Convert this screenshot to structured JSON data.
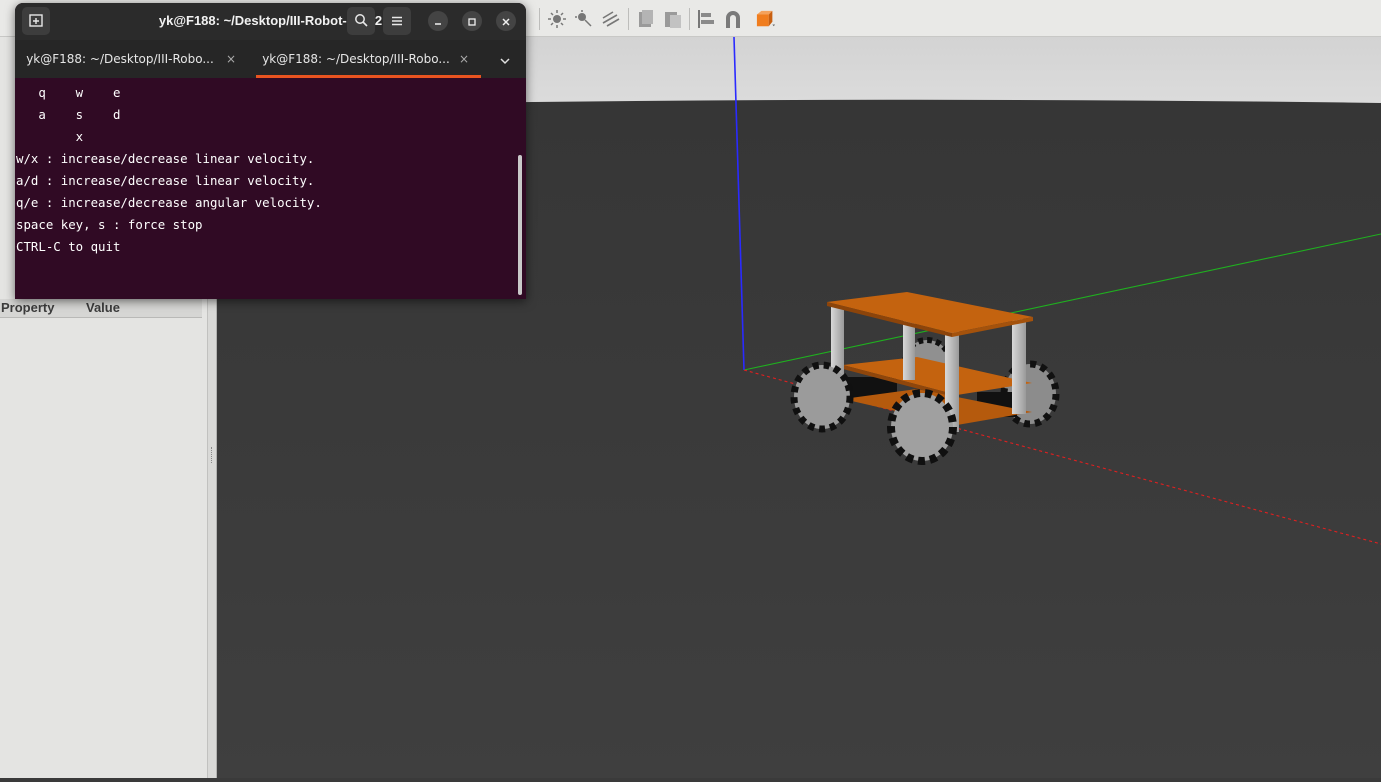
{
  "terminal": {
    "title": "yk@F188: ~/Desktop/III-Robot-ROS2",
    "tabs": [
      {
        "label": "yk@F188: ~/Desktop/III-Robo...",
        "close": "×"
      },
      {
        "label": "yk@F188: ~/Desktop/III-Robo...",
        "close": "×"
      }
    ],
    "active_tab": 1,
    "lines": [
      "   q    w    e",
      "   a    s    d",
      "        x",
      "w/x : increase/decrease linear velocity.",
      "a/d : increase/decrease linear velocity.",
      "q/e : increase/decrease angular velocity.",
      "space key, s : force stop",
      "CTRL-C to quit"
    ],
    "header_icons": [
      "new-tab-icon",
      "search-icon",
      "hamburger-menu-icon",
      "minimize-icon",
      "maximize-icon",
      "close-icon",
      "chevron-down-icon"
    ]
  },
  "gazebo": {
    "property_panel": {
      "col_property": "Property",
      "col_value": "Value"
    },
    "toolbar_icons": [
      "sun-light-icon",
      "spot-light-icon",
      "directional-light-icon",
      "copy-icon",
      "paste-icon",
      "align-icon",
      "snap-icon",
      "view-angle-icon"
    ],
    "colors": {
      "sky": "#d6d6d6",
      "ground": "#3b3b3b",
      "robot_plate": "#c4630f",
      "x_axis": "#ff2020",
      "y_axis": "#20c020",
      "z_axis": "#2020ff"
    }
  }
}
